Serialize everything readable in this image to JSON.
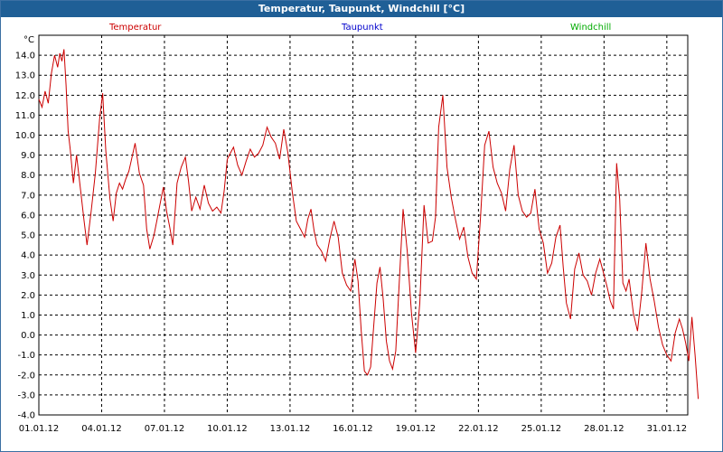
{
  "window": {
    "title": "Temperatur, Taupunkt, Windchill [°C]"
  },
  "colors": {
    "title_bg": "#1f5f96",
    "temperature": "#cc0000",
    "dewpoint": "#0000cc",
    "windchill": "#00aa00",
    "grid": "#000000"
  },
  "chart_data": {
    "type": "line",
    "title": "Temperatur, Taupunkt, Windchill [°C]",
    "ylabel": "°C",
    "xlabel": "",
    "ylim": [
      -4.0,
      15.0
    ],
    "xlim": [
      "01.01.12",
      "01.02.12"
    ],
    "x_ticks": [
      "01.01.12",
      "04.01.12",
      "07.01.12",
      "10.01.12",
      "13.01.12",
      "16.01.12",
      "19.01.12",
      "22.01.12",
      "25.01.12",
      "28.01.12",
      "31.01.12"
    ],
    "y_ticks": [
      "-4.0",
      "-3.0",
      "-2.0",
      "-1.0",
      "0.0",
      "1.0",
      "2.0",
      "3.0",
      "4.0",
      "5.0",
      "6.0",
      "7.0",
      "8.0",
      "9.0",
      "10.0",
      "11.0",
      "12.0",
      "13.0",
      "14.0"
    ],
    "grid": true,
    "legend": [
      "Temperatur",
      "Taupunkt",
      "Windchill"
    ],
    "legend_position": "top",
    "series": [
      {
        "name": "Temperatur",
        "x_days": [
          0.0,
          0.15,
          0.3,
          0.45,
          0.6,
          0.75,
          0.9,
          1.0,
          1.1,
          1.2,
          1.3,
          1.4,
          1.5,
          1.65,
          1.8,
          2.0,
          2.15,
          2.3,
          2.5,
          2.7,
          2.9,
          3.05,
          3.2,
          3.4,
          3.55,
          3.7,
          3.85,
          4.0,
          4.15,
          4.3,
          4.45,
          4.6,
          4.8,
          5.0,
          5.15,
          5.3,
          5.5,
          5.65,
          5.8,
          5.95,
          6.1,
          6.25,
          6.4,
          6.6,
          6.8,
          7.0,
          7.15,
          7.3,
          7.5,
          7.7,
          7.9,
          8.1,
          8.3,
          8.5,
          8.7,
          8.85,
          9.0,
          9.15,
          9.3,
          9.5,
          9.7,
          9.9,
          10.1,
          10.3,
          10.5,
          10.7,
          10.9,
          11.1,
          11.3,
          11.5,
          11.7,
          11.9,
          12.1,
          12.3,
          12.5,
          12.7,
          12.85,
          13.0,
          13.15,
          13.3,
          13.5,
          13.7,
          13.9,
          14.1,
          14.3,
          14.5,
          14.7,
          14.9,
          15.1,
          15.25,
          15.4,
          15.55,
          15.7,
          15.85,
          16.0,
          16.15,
          16.3,
          16.45,
          16.6,
          16.75,
          16.9,
          17.05,
          17.2,
          17.4,
          17.6,
          17.8,
          18.0,
          18.2,
          18.4,
          18.6,
          18.8,
          18.95,
          19.1,
          19.3,
          19.5,
          19.7,
          19.9,
          20.1,
          20.3,
          20.5,
          20.7,
          20.9,
          21.1,
          21.3,
          21.5,
          21.7,
          21.9,
          22.1,
          22.3,
          22.5,
          22.7,
          22.9,
          23.1,
          23.3,
          23.5,
          23.7,
          23.9,
          24.1,
          24.3,
          24.5,
          24.7,
          24.9,
          25.05,
          25.2,
          25.4,
          25.6,
          25.8,
          26.0,
          26.2,
          26.4,
          26.6,
          26.8,
          27.0,
          27.15,
          27.3,
          27.45,
          27.6,
          27.75,
          27.9,
          28.05,
          28.2,
          28.4,
          28.6,
          28.8,
          29.0,
          29.2,
          29.4,
          29.6,
          29.8,
          30.0,
          30.2,
          30.4,
          30.6,
          30.75,
          30.9,
          31.05,
          31.2,
          31.35,
          31.5
        ],
        "values": [
          11.8,
          11.4,
          12.2,
          11.6,
          13.1,
          14.0,
          13.4,
          14.1,
          13.7,
          14.3,
          12.5,
          10.2,
          9.3,
          7.6,
          9.0,
          7.2,
          5.8,
          4.5,
          6.2,
          8.1,
          10.8,
          12.1,
          9.2,
          6.8,
          5.7,
          7.1,
          7.6,
          7.3,
          7.8,
          8.2,
          8.9,
          9.6,
          8.1,
          7.5,
          5.3,
          4.3,
          5.0,
          5.8,
          6.6,
          7.4,
          6.2,
          5.4,
          4.5,
          7.6,
          8.4,
          8.9,
          7.7,
          6.2,
          6.9,
          6.3,
          7.5,
          6.6,
          6.2,
          6.4,
          6.1,
          7.2,
          8.8,
          9.1,
          9.4,
          8.5,
          8.0,
          8.7,
          9.3,
          8.9,
          9.1,
          9.5,
          10.4,
          9.9,
          9.6,
          8.8,
          10.3,
          9.1,
          7.2,
          5.7,
          5.3,
          4.9,
          5.8,
          6.3,
          5.2,
          4.5,
          4.2,
          3.7,
          4.8,
          5.7,
          4.9,
          3.1,
          2.5,
          2.2,
          3.8,
          2.7,
          0.2,
          -1.8,
          -2.0,
          -1.6,
          0.5,
          2.6,
          3.4,
          1.8,
          -0.3,
          -1.3,
          -1.7,
          -0.8,
          2.3,
          6.3,
          4.2,
          1.1,
          -0.9,
          1.6,
          6.5,
          4.6,
          4.7,
          5.9,
          10.4,
          12.0,
          8.4,
          6.9,
          5.8,
          4.8,
          5.4,
          3.9,
          3.1,
          2.8,
          5.9,
          9.5,
          10.2,
          8.4,
          7.6,
          7.1,
          6.2,
          8.3,
          9.5,
          7.0,
          6.2,
          5.9,
          6.1,
          7.3,
          5.3,
          4.6,
          3.1,
          3.6,
          4.9,
          5.5,
          3.4,
          1.6,
          0.8,
          3.3,
          4.1,
          3.0,
          2.7,
          2.0,
          3.1,
          3.8,
          3.0,
          2.4,
          1.7,
          1.3,
          8.6,
          6.8,
          2.6,
          2.2,
          2.8,
          1.1,
          0.2,
          2.1,
          4.6,
          2.8,
          1.7,
          0.4,
          -0.5,
          -1.0,
          -1.3,
          0.1,
          0.8,
          0.3,
          -0.4,
          -1.3,
          0.9,
          -1.0,
          -3.2
        ]
      },
      {
        "name": "Taupunkt",
        "x_days": [],
        "values": []
      },
      {
        "name": "Windchill",
        "x_days": [],
        "values": []
      }
    ]
  }
}
